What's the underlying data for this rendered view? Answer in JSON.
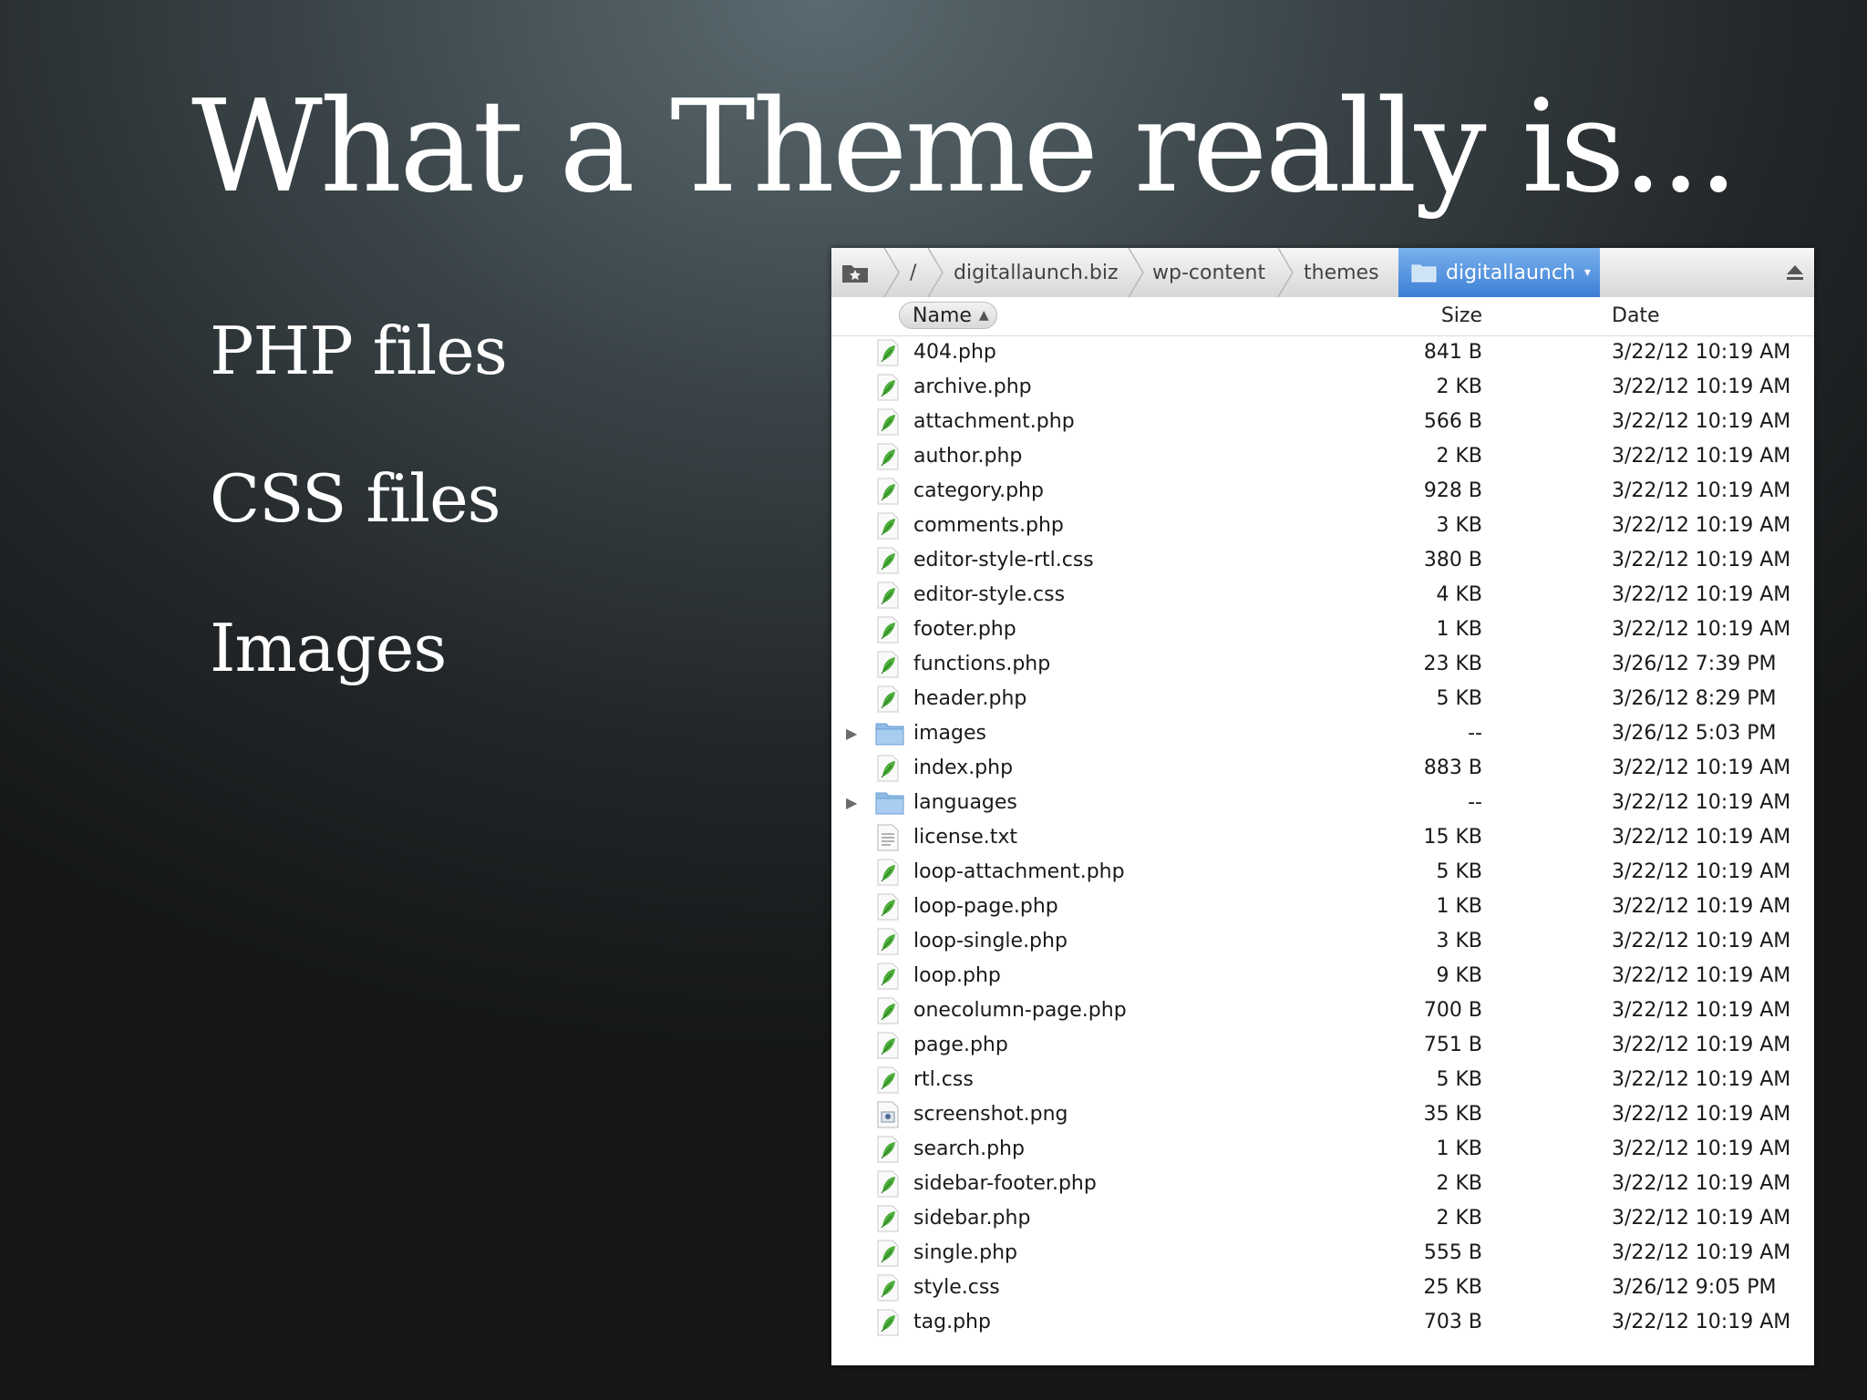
{
  "slide": {
    "title": "What a Theme really is...",
    "bullets": [
      "PHP files",
      "CSS files",
      "Images"
    ]
  },
  "browser": {
    "path": {
      "favorites_icon": "star-folder-icon",
      "segments": [
        "/",
        "digitallaunch.biz",
        "wp-content",
        "themes"
      ],
      "current": "digitallaunch",
      "eject_icon": "eject-icon"
    },
    "columns": {
      "name": "Name",
      "size": "Size",
      "date": "Date"
    },
    "files": [
      {
        "name": "404.php",
        "size": "841 B",
        "date": "3/22/12 10:19 AM",
        "type": "php"
      },
      {
        "name": "archive.php",
        "size": "2 KB",
        "date": "3/22/12 10:19 AM",
        "type": "php"
      },
      {
        "name": "attachment.php",
        "size": "566 B",
        "date": "3/22/12 10:19 AM",
        "type": "php"
      },
      {
        "name": "author.php",
        "size": "2 KB",
        "date": "3/22/12 10:19 AM",
        "type": "php"
      },
      {
        "name": "category.php",
        "size": "928 B",
        "date": "3/22/12 10:19 AM",
        "type": "php"
      },
      {
        "name": "comments.php",
        "size": "3 KB",
        "date": "3/22/12 10:19 AM",
        "type": "php"
      },
      {
        "name": "editor-style-rtl.css",
        "size": "380 B",
        "date": "3/22/12 10:19 AM",
        "type": "php"
      },
      {
        "name": "editor-style.css",
        "size": "4 KB",
        "date": "3/22/12 10:19 AM",
        "type": "php"
      },
      {
        "name": "footer.php",
        "size": "1 KB",
        "date": "3/22/12 10:19 AM",
        "type": "php"
      },
      {
        "name": "functions.php",
        "size": "23 KB",
        "date": "3/26/12 7:39 PM",
        "type": "php"
      },
      {
        "name": "header.php",
        "size": "5 KB",
        "date": "3/26/12 8:29 PM",
        "type": "php"
      },
      {
        "name": "images",
        "size": "--",
        "date": "3/26/12 5:03 PM",
        "type": "folder"
      },
      {
        "name": "index.php",
        "size": "883 B",
        "date": "3/22/12 10:19 AM",
        "type": "php"
      },
      {
        "name": "languages",
        "size": "--",
        "date": "3/22/12 10:19 AM",
        "type": "folder"
      },
      {
        "name": "license.txt",
        "size": "15 KB",
        "date": "3/22/12 10:19 AM",
        "type": "text"
      },
      {
        "name": "loop-attachment.php",
        "size": "5 KB",
        "date": "3/22/12 10:19 AM",
        "type": "php"
      },
      {
        "name": "loop-page.php",
        "size": "1 KB",
        "date": "3/22/12 10:19 AM",
        "type": "php"
      },
      {
        "name": "loop-single.php",
        "size": "3 KB",
        "date": "3/22/12 10:19 AM",
        "type": "php"
      },
      {
        "name": "loop.php",
        "size": "9 KB",
        "date": "3/22/12 10:19 AM",
        "type": "php"
      },
      {
        "name": "onecolumn-page.php",
        "size": "700 B",
        "date": "3/22/12 10:19 AM",
        "type": "php"
      },
      {
        "name": "page.php",
        "size": "751 B",
        "date": "3/22/12 10:19 AM",
        "type": "php"
      },
      {
        "name": "rtl.css",
        "size": "5 KB",
        "date": "3/22/12 10:19 AM",
        "type": "php"
      },
      {
        "name": "screenshot.png",
        "size": "35 KB",
        "date": "3/22/12 10:19 AM",
        "type": "image"
      },
      {
        "name": "search.php",
        "size": "1 KB",
        "date": "3/22/12 10:19 AM",
        "type": "php"
      },
      {
        "name": "sidebar-footer.php",
        "size": "2 KB",
        "date": "3/22/12 10:19 AM",
        "type": "php"
      },
      {
        "name": "sidebar.php",
        "size": "2 KB",
        "date": "3/22/12 10:19 AM",
        "type": "php"
      },
      {
        "name": "single.php",
        "size": "555 B",
        "date": "3/22/12 10:19 AM",
        "type": "php"
      },
      {
        "name": "style.css",
        "size": "25 KB",
        "date": "3/26/12 9:05 PM",
        "type": "php"
      },
      {
        "name": "tag.php",
        "size": "703 B",
        "date": "3/22/12 10:19 AM",
        "type": "php"
      }
    ]
  },
  "colors": {
    "accent": "#3c7fd6",
    "leaf_green": "#4caf3a",
    "folder_blue": "#8fbbe6"
  }
}
